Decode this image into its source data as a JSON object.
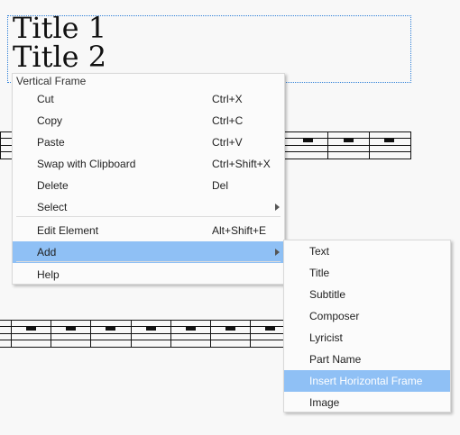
{
  "score": {
    "titles": [
      "Title 1",
      "Title 2"
    ]
  },
  "context_menu": {
    "header": "Vertical Frame",
    "items": [
      {
        "label": "Cut",
        "shortcut": "Ctrl+X"
      },
      {
        "label": "Copy",
        "shortcut": "Ctrl+C"
      },
      {
        "label": "Paste",
        "shortcut": "Ctrl+V"
      },
      {
        "label": "Swap with Clipboard",
        "shortcut": "Ctrl+Shift+X"
      },
      {
        "label": "Delete",
        "shortcut": "Del"
      },
      {
        "label": "Select",
        "shortcut": ""
      },
      {
        "label": "Edit Element",
        "shortcut": "Alt+Shift+E"
      },
      {
        "label": "Add",
        "shortcut": ""
      },
      {
        "label": "Help",
        "shortcut": ""
      }
    ]
  },
  "add_submenu": {
    "items": [
      {
        "label": "Text"
      },
      {
        "label": "Title"
      },
      {
        "label": "Subtitle"
      },
      {
        "label": "Composer"
      },
      {
        "label": "Lyricist"
      },
      {
        "label": "Part Name"
      },
      {
        "label": "Insert Horizontal Frame"
      },
      {
        "label": "Image"
      }
    ]
  },
  "colors": {
    "highlight": "#8fc0f5",
    "frame_border": "#2d7fd8",
    "menu_bg": "#fbfbfb"
  },
  "icons": {
    "submenu_arrow": "chevron-right-icon"
  }
}
